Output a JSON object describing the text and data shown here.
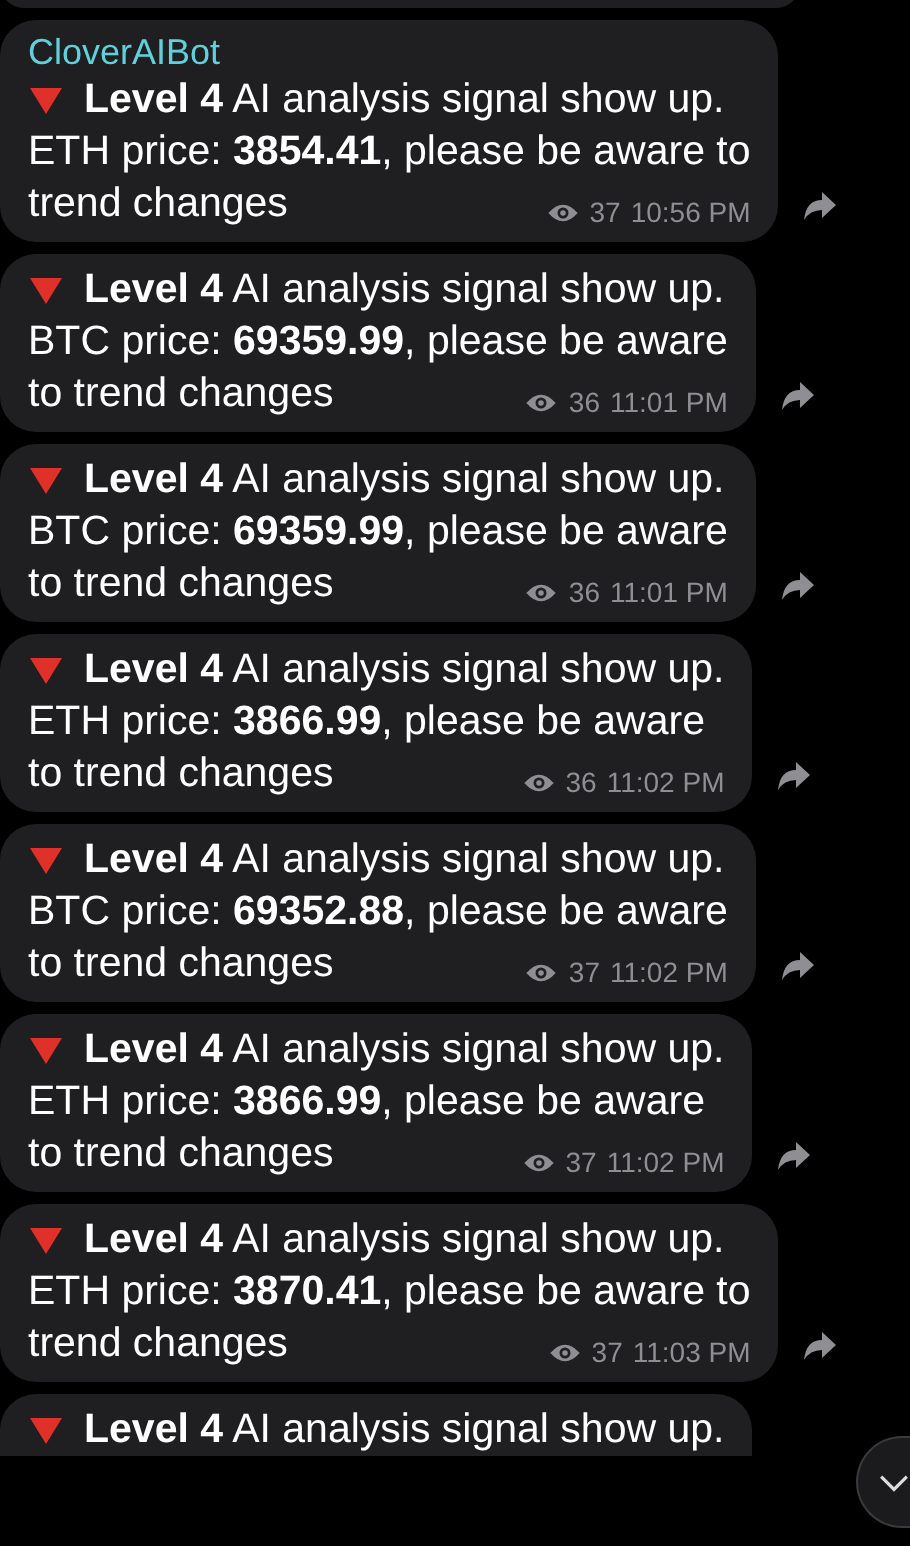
{
  "messages": [
    {
      "kind": "partial-top"
    },
    {
      "kind": "message",
      "sender": "CloverAIBot",
      "lines": [
        "**Level 4** AI analysis signal show up.",
        "ETH price: **3854.41**, please be aware to",
        "trend changes"
      ],
      "views": "37",
      "time": "10:56 PM"
    },
    {
      "kind": "message",
      "lines": [
        "**Level 4** AI analysis signal show up.",
        "BTC price: **69359.99**, please be aware",
        "to trend changes"
      ],
      "views": "36",
      "time": "11:01 PM"
    },
    {
      "kind": "message",
      "lines": [
        "**Level 4** AI analysis signal show up.",
        "BTC price: **69359.99**, please be aware",
        "to trend changes"
      ],
      "views": "36",
      "time": "11:01 PM"
    },
    {
      "kind": "message",
      "lines": [
        "**Level 4** AI analysis signal show up.",
        "ETH price: **3866.99**, please be aware",
        "to trend changes"
      ],
      "views": "36",
      "time": "11:02 PM"
    },
    {
      "kind": "message",
      "lines": [
        "**Level 4** AI analysis signal show up.",
        "BTC price: **69352.88**, please be aware",
        "to trend changes"
      ],
      "views": "37",
      "time": "11:02 PM"
    },
    {
      "kind": "message",
      "lines": [
        "**Level 4** AI analysis signal show up.",
        "ETH price: **3866.99**, please be aware",
        "to trend changes"
      ],
      "views": "37",
      "time": "11:02 PM"
    },
    {
      "kind": "message",
      "lines": [
        "**Level 4** AI analysis signal show up.",
        "ETH price: **3870.41**, please be aware to",
        "trend changes"
      ],
      "views": "37",
      "time": "11:03 PM"
    },
    {
      "kind": "partial-bottom",
      "lines": [
        "**Level 4** AI analysis signal show up."
      ]
    }
  ]
}
